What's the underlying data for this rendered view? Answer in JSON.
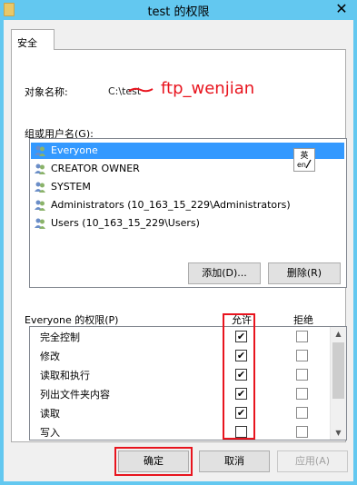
{
  "window": {
    "title": "test 的权限",
    "close_glyph": "✕"
  },
  "tab": {
    "label": "安全"
  },
  "object": {
    "label": "对象名称:",
    "value": "C:\\test"
  },
  "annotation": {
    "text": "ftp_wenjian",
    "color": "#e8141e"
  },
  "groups": {
    "label": "组或用户名(G):",
    "items": [
      {
        "name": "Everyone",
        "selected": true,
        "icon": "users-icon"
      },
      {
        "name": "CREATOR OWNER",
        "selected": false,
        "icon": "users-icon"
      },
      {
        "name": "SYSTEM",
        "selected": false,
        "icon": "users-icon"
      },
      {
        "name": "Administrators (10_163_15_229\\Administrators)",
        "selected": false,
        "icon": "users-icon"
      },
      {
        "name": "Users (10_163_15_229\\Users)",
        "selected": false,
        "icon": "users-icon"
      }
    ],
    "ime_glyph": "英"
  },
  "buttons": {
    "add": "添加(D)...",
    "remove": "删除(R)",
    "ok": "确定",
    "cancel": "取消",
    "apply": "应用(A)"
  },
  "permissions": {
    "label": "Everyone 的权限(P)",
    "allow_header": "允许",
    "deny_header": "拒绝",
    "rows": [
      {
        "name": "完全控制",
        "allow": true,
        "deny": false
      },
      {
        "name": "修改",
        "allow": true,
        "deny": false
      },
      {
        "name": "读取和执行",
        "allow": true,
        "deny": false
      },
      {
        "name": "列出文件夹内容",
        "allow": true,
        "deny": false
      },
      {
        "name": "读取",
        "allow": true,
        "deny": false
      },
      {
        "name": "写入",
        "allow": false,
        "deny": false
      }
    ]
  },
  "colors": {
    "title_bar": "#63c8f0",
    "selection": "#3399ff",
    "highlight_box": "#e8141e"
  }
}
